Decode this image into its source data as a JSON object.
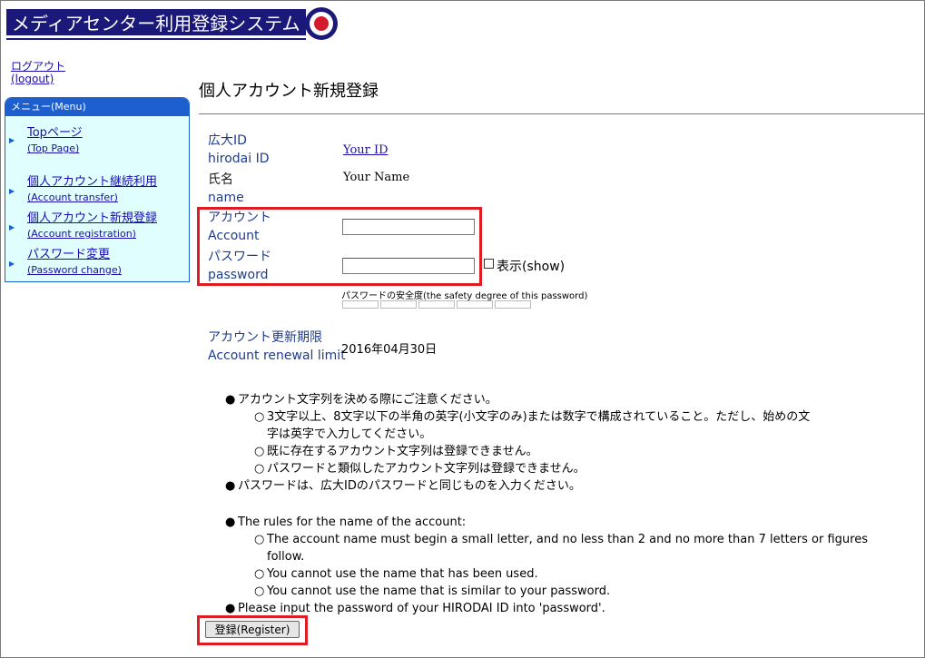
{
  "header": {
    "banner_title": "メディアセンター利用登録システム",
    "logo_icon": "hirodai-logo-icon"
  },
  "logout": {
    "ja": "ログアウト",
    "en": "(logout)"
  },
  "menu": {
    "title": "メニュー(Menu)",
    "items": [
      {
        "ja": "Topページ",
        "en": "(Top Page)"
      },
      {
        "ja": "個人アカウント継続利用",
        "en": "(Account transfer)"
      },
      {
        "ja": "個人アカウント新規登録",
        "en": "(Account registration)"
      },
      {
        "ja": "パスワード変更",
        "en": "(Password change)"
      }
    ]
  },
  "page": {
    "title": "個人アカウント新規登録"
  },
  "form": {
    "hirodai_id": {
      "ja": "広大ID",
      "en": "hirodai ID",
      "value": "Your ID"
    },
    "name": {
      "ja": "氏名",
      "en": "name",
      "value": "Your Name"
    },
    "account": {
      "ja": "アカウント",
      "en": "Account",
      "value": ""
    },
    "password": {
      "ja": "パスワード",
      "en": "password",
      "value": ""
    },
    "show_label": "表示(show)",
    "show_checked": false,
    "safety_label": "パスワードの安全度(the safety degree of this password)",
    "safety_level": 0,
    "renewal": {
      "ja": "アカウント更新期限",
      "en": "Account renewal limit",
      "value": "2016年04月30日"
    }
  },
  "notes_ja": {
    "rule_head": "アカウント文字列を決める際にご注意ください。",
    "sub1_line1": "3文字以上、8文字以下の半角の英字(小文字のみ)または数字で構成されていること。ただし、始めの文",
    "sub1_line2": "字は英字で入力してください。",
    "sub2": "既に存在するアカウント文字列は登録できません。",
    "sub3": "パスワードと類似したアカウント文字列は登録できません。",
    "pw_note": "パスワードは、広大IDのパスワードと同じものを入力ください。"
  },
  "notes_en": {
    "rule_head": "The rules for the name of the account:",
    "sub1_line1": "The account name must begin a small letter, and no less than 2 and no more than 7 letters or figures",
    "sub1_line2": "follow.",
    "sub2": "You cannot use the name that has been used.",
    "sub3": "You cannot use the name that is similar to your password.",
    "pw_note": "Please input the password of your HIRODAI ID into 'password'."
  },
  "register_button": "登録(Register)",
  "colors": {
    "banner": "#1a1878",
    "menu_border": "#1d5fcf",
    "menu_bg": "#e0fefe",
    "highlight": "#e11b22",
    "label_blue": "#1d3c8d"
  }
}
